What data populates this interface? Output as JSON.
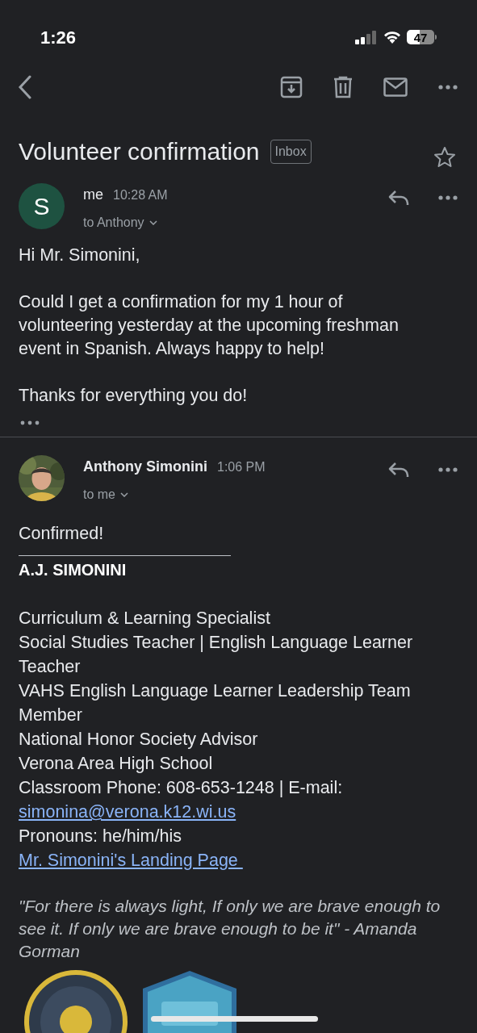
{
  "status_bar": {
    "time": "1:26",
    "battery": "47"
  },
  "subject": {
    "title": "Volunteer confirmation",
    "label": "Inbox",
    "starred": false
  },
  "messages": [
    {
      "sender": "me",
      "time": "10:28 AM",
      "recipient": "to Anthony",
      "avatar": {
        "kind": "initial",
        "letter": "S",
        "color": "#1e5241"
      },
      "body": [
        {
          "kind": "text",
          "text": "Hi Mr. Simonini,"
        },
        {
          "kind": "text",
          "text": "Could I get a confirmation for my 1 hour of volunteering yesterday at the upcoming freshman event in Spanish. Always happy to help!"
        },
        {
          "kind": "text",
          "text": "Thanks for everything you do!"
        }
      ],
      "trimmed": true
    },
    {
      "sender": "Anthony Simonini",
      "time": "1:06 PM",
      "recipient": "to me",
      "avatar": {
        "kind": "picture"
      },
      "body": [
        {
          "kind": "text",
          "text": "Confirmed!"
        }
      ],
      "signature": {
        "name": "A.J. SIMONINI",
        "lines": [
          {
            "kind": "text",
            "text": "Curriculum & Learning Specialist"
          },
          {
            "kind": "text",
            "text": "Social Studies Teacher | English Language Learner Teacher"
          },
          {
            "kind": "text",
            "text": "VAHS English Language Learner Leadership Team Member"
          },
          {
            "kind": "text",
            "text": "National Honor Society Advisor"
          },
          {
            "kind": "text",
            "text": "Verona Area High School"
          },
          {
            "kind": "text",
            "text": "Classroom Phone: 608-653-1248 | E-mail:"
          },
          {
            "kind": "link",
            "text": "simonina@verona.k12.wi.us"
          },
          {
            "kind": "text",
            "text": "Pronouns: he/him/his"
          },
          {
            "kind": "link",
            "text": "Mr. Simonini's Landing Page "
          }
        ],
        "quote": "\"For there is always light, If only we are brave enough to see it. If only we are brave enough to be it\" - Amanda Gorman",
        "badges": [
          {
            "kind": "picture"
          },
          {
            "kind": "picture"
          }
        ]
      }
    }
  ]
}
